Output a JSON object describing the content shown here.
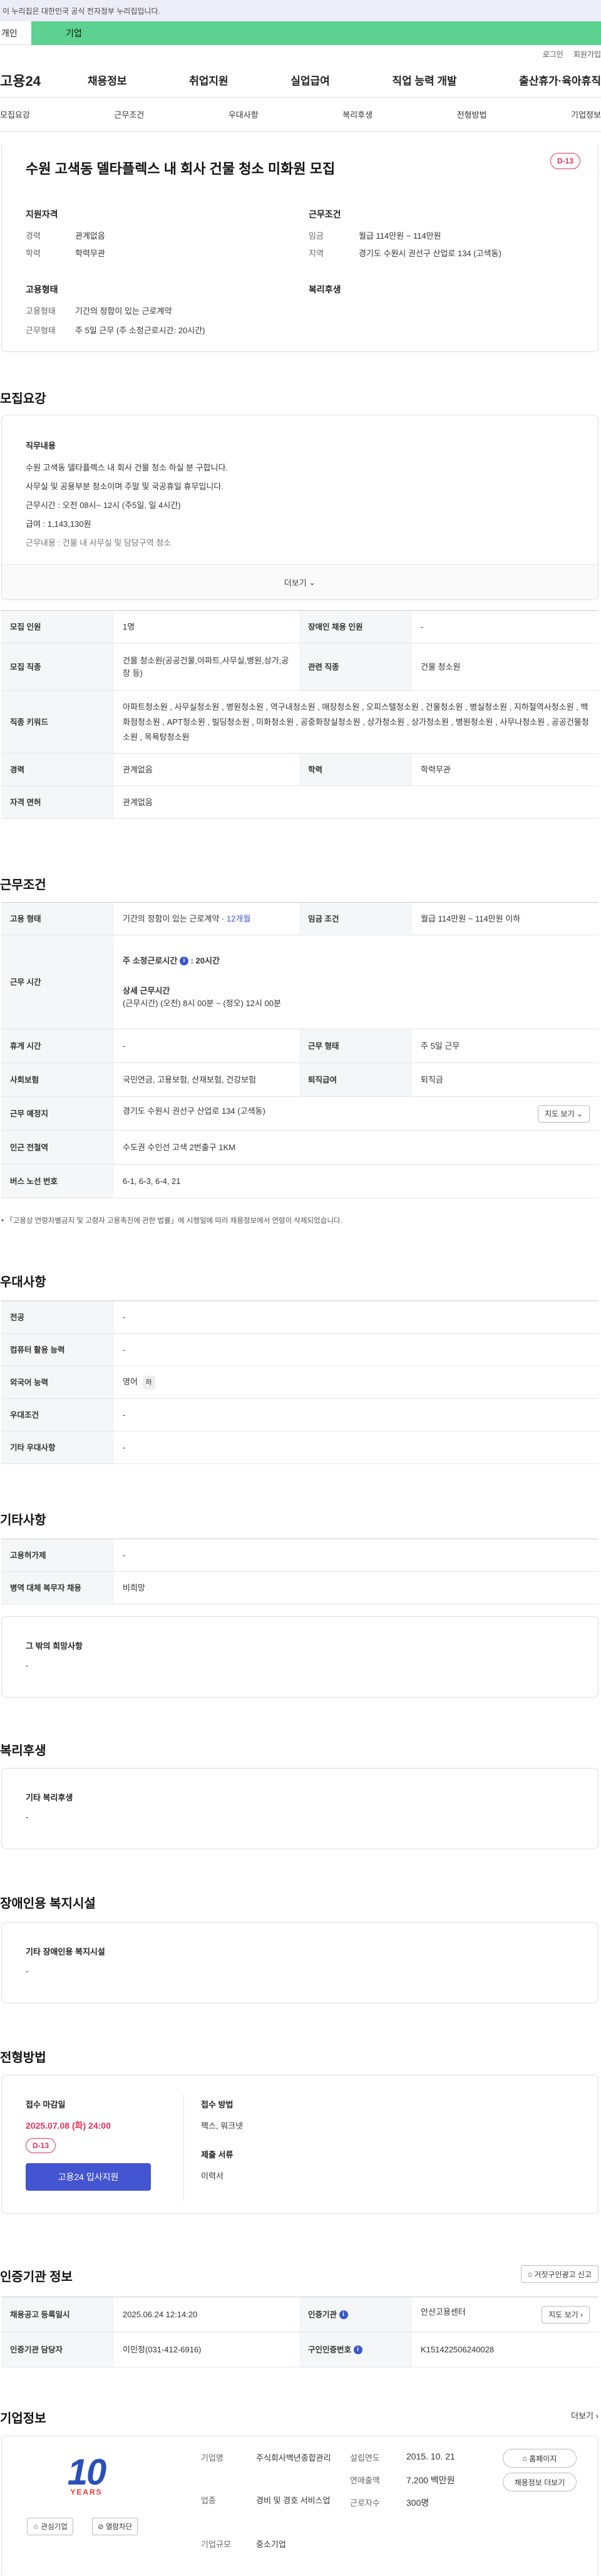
{
  "gov_banner": "이 누리집은 대한민국 공식 전자정부 누리집입니다.",
  "tabs": {
    "personal": "개인",
    "company": "기업"
  },
  "util": {
    "login": "로그인",
    "join": "회원가입"
  },
  "logo": "고용24",
  "gnb": [
    "채용정보",
    "취업지원",
    "실업급여",
    "직업 능력 개발",
    "출산휴가·육아휴직"
  ],
  "subnav": [
    "모집요강",
    "근무조건",
    "우대사항",
    "복리후생",
    "전형방법",
    "기업정보"
  ],
  "job": {
    "title": "수원 고색동 델타플렉스 내 회사 건물 청소 미화원 모집",
    "dday": "D-13"
  },
  "summary": {
    "qual_title": "지원자격",
    "career_lbl": "경력",
    "career_val": "관계없음",
    "edu_lbl": "학력",
    "edu_val": "학력무관",
    "cond_title": "근무조건",
    "wage_lbl": "임금",
    "wage_val": "월급 114만원 ~ 114만원",
    "area_lbl": "지역",
    "area_val": "경기도 수원시 권선구 산업로 134 (고색동)",
    "emp_title": "고용형태",
    "emptype_lbl": "고용형태",
    "emptype_val": "기간의 정함이 있는 근로계약",
    "worktype_lbl": "근무형태",
    "worktype_val": "주 5일 근무 (주 소정근로시간: 20시간)",
    "welfare_title": "복리후생"
  },
  "recruit": {
    "title": "모집요강",
    "duty_title": "직무내용",
    "lines": [
      "수원 고색동 델타플렉스 내 회사 건물 청소 하실 분 구합니다.",
      "사무실 및 공용부분 청소이며 주말 및 국공휴일 휴무입니다.",
      "근무시간 : 오전 08시~ 12시 (주5일, 일 4시간)",
      "급여 : 1,143,130원",
      "근무내용 : 건물 내 사무실 및 담당구역 청소"
    ],
    "more": "더보기",
    "t_people": "모집 인원",
    "v_people": "1명",
    "t_disabled": "장애인 채용 인원",
    "v_disabled": "-",
    "t_job": "모집 직종",
    "v_job": "건물 청소원(공공건물,아파트,사무실,병원,상가,공장 등)",
    "t_related": "관련 직종",
    "v_related": "건물 청소원",
    "t_keyword": "직종 키워드",
    "v_keyword": "아파트청소원 , 사무실청소원 , 병원청소원 , 역구내청소원 , 매장청소원 , 오피스텔청소원 , 건물청소원 , 병실청소원 , 지하철역사청소원 , 백화점청소원 , APT청소원 , 빌딩청소원 , 미화청소원 , 공중화장실청소원 , 상가청소원 , 상가청소원 , 병원청소원 , 사무나청소원 , 공공건물청소원 , 목욕탕청소원",
    "t_career": "경력",
    "v_career": "관계없음",
    "t_edu": "학력",
    "v_edu": "학력무관",
    "t_license": "자격 면허",
    "v_license": "관계없음"
  },
  "cond": {
    "title": "근무조건",
    "t_emp": "고용 형태",
    "v_emp": "기간의 정함이 있는 근로계약 · ",
    "v_emp_link": "12개월",
    "t_wage": "임금 조건",
    "v_wage": "월급 114만원 ~ 114만원 이하",
    "t_time": "근무 시간",
    "v_time_a": "주 소정근로시간",
    "v_time_b": "20시간",
    "v_time_c": "상세 근무시간",
    "v_time_d": "(근무시간) (오전) 8시 00분 ~ (정오) 12시 00분",
    "t_rest": "휴게 시간",
    "v_rest": "-",
    "t_form": "근무 형태",
    "v_form": "주 5일 근무",
    "t_ins": "사회보험",
    "v_ins": "국민연금, 고용보험, 산재보험, 건강보험",
    "t_retire": "퇴직급여",
    "v_retire": "퇴직금",
    "t_place": "근무 예정지",
    "v_place": "경기도 수원시 권선구 산업로 134 (고색동)",
    "map": "지도 보기",
    "t_subway": "인근 전철역",
    "v_subway": "수도권 수인선 고색 2번출구 1KM",
    "t_bus": "버스 노선 번호",
    "v_bus": "6-1, 6-3, 6-4, 21",
    "note": "「고용상 연령차별금지 및 고령자 고용촉진에 관한 법률」에 시행일에 따라 채용정보에서 연령이 삭제되었습니다."
  },
  "pref": {
    "title": "우대사항",
    "rows": [
      [
        "전공",
        "-"
      ],
      [
        "컴퓨터 활용 능력",
        "-"
      ],
      [
        "외국어 능력",
        "영어"
      ],
      [
        "우대조건",
        "-"
      ],
      [
        "기타 우대사항",
        "-"
      ]
    ],
    "lang_badge": "하"
  },
  "etc": {
    "title": "기타사항",
    "rows": [
      [
        "고용허가제",
        "-"
      ],
      [
        "병역 대체 복무자 채용",
        "비희망"
      ]
    ],
    "box_title": "그 밖의 희망사항",
    "box_val": "-"
  },
  "welfare": {
    "title": "복리후생",
    "box_title": "기타 복리후생",
    "box_val": "-"
  },
  "facility": {
    "title": "장애인용 복지시설",
    "box_title": "기타 장애인용 복지시설",
    "box_val": "-"
  },
  "apply": {
    "title": "전형방법",
    "deadline_lbl": "접수 마감일",
    "deadline": "2025.07.08 (화) 24:00",
    "dday": "D-13",
    "apply_btn": "고용24 입사지원",
    "method_lbl": "접수 방법",
    "method_val": "팩스, 워크넷",
    "doc_lbl": "제출 서류",
    "doc_val": "이력서"
  },
  "cert": {
    "title": "인증기관 정보",
    "report": "거짓구인광고 신고",
    "t_reg": "채용공고 등록일시",
    "v_reg": "2025.06.24 12:14:20",
    "t_org": "인증기관",
    "v_org": "안산고용센터",
    "map": "지도 보기",
    "t_mgr": "인증기관 담당자",
    "v_mgr": "이민정(031-412-6916)",
    "t_no": "구인인증번호",
    "v_no": "K151422506240028"
  },
  "company": {
    "title": "기업정보",
    "more": "더보기",
    "logo_text": "YEARS",
    "logo_num": "10",
    "fav": "관심기업",
    "block": "열람차단",
    "t_name": "기업명",
    "v_name": "주식회사백년종합관리",
    "t_year": "설립연도",
    "v_year": "2015. 10. 21",
    "home": "홈페이지",
    "t_biz": "업종",
    "v_biz": "경비 및 경호 서비스업",
    "t_sales": "연매출액",
    "v_sales": "7,200 백만원",
    "jobs": "채용정보 더보기",
    "t_emp": "근로자수",
    "v_emp": "300명",
    "t_size": "기업규모",
    "v_size": "중소기업"
  },
  "colors": {
    "accent": "#5dd18f",
    "primary": "#3b57c7",
    "danger": "#e5335a"
  }
}
